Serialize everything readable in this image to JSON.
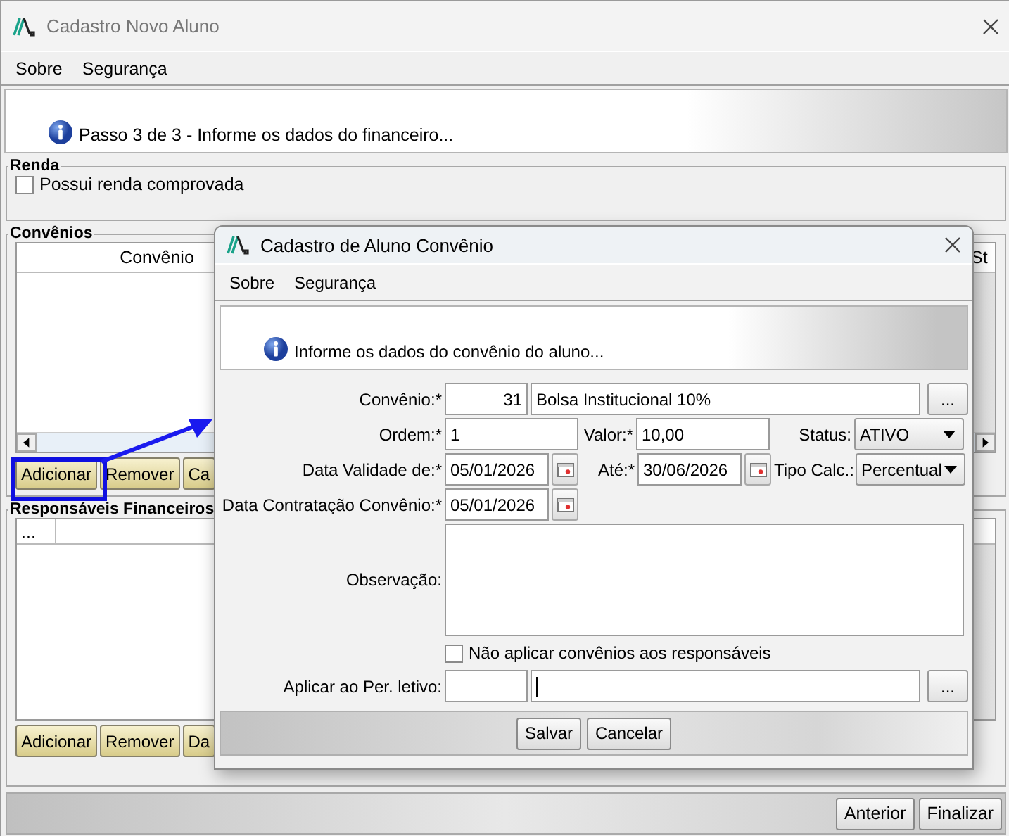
{
  "window": {
    "title": "Cadastro Novo Aluno"
  },
  "menu": [
    "Sobre",
    "Segurança"
  ],
  "header": {
    "message": "Passo 3 de 3 - Informe os dados do financeiro..."
  },
  "renda": {
    "title": "Renda",
    "checkbox": {
      "label": "Possui renda comprovada",
      "checked": false
    }
  },
  "convenios": {
    "title": "Convênios",
    "columns": [
      "Convênio",
      "St"
    ],
    "buttons": [
      "Adicionar",
      "Remover",
      "Ca"
    ]
  },
  "responsaveis": {
    "title": "Responsáveis Financeiros",
    "columns": [
      "..."
    ],
    "buttons": [
      "Adicionar",
      "Remover",
      "Da"
    ]
  },
  "footer_buttons": [
    "Anterior",
    "Finalizar"
  ],
  "dialog": {
    "title": "Cadastro de Aluno Convênio",
    "menu": [
      "Sobre",
      "Segurança"
    ],
    "message": "Informe os dados do convênio do aluno...",
    "convenio": {
      "label": "Convênio:*",
      "code": "31",
      "name": "Bolsa Institucional 10%",
      "button": "..."
    },
    "ordem": {
      "label": "Ordem:*",
      "value": "1"
    },
    "valor": {
      "label": "Valor:*",
      "value": "10,00"
    },
    "status": {
      "label": "Status:",
      "value": "ATIVO"
    },
    "validade_de": {
      "label": "Data Validade de:*",
      "value": "05/01/2026"
    },
    "ate": {
      "label": "Até:*",
      "value": "30/06/2026"
    },
    "tipo_calc": {
      "label": "Tipo Calc.:",
      "value": "Percentual"
    },
    "data_contratacao": {
      "label": "Data Contratação Convênio:*",
      "value": "05/01/2026"
    },
    "observacao": {
      "label": "Observação:"
    },
    "nao_aplicar": {
      "label": "Não aplicar convênios aos responsáveis",
      "checked": false
    },
    "periodo": {
      "label": "Aplicar ao Per. letivo:",
      "button": "..."
    },
    "buttons": [
      "Salvar",
      "Cancelar"
    ]
  },
  "annotations": [
    {
      "kind": "highlight"
    },
    {
      "kind": "arrow"
    }
  ]
}
